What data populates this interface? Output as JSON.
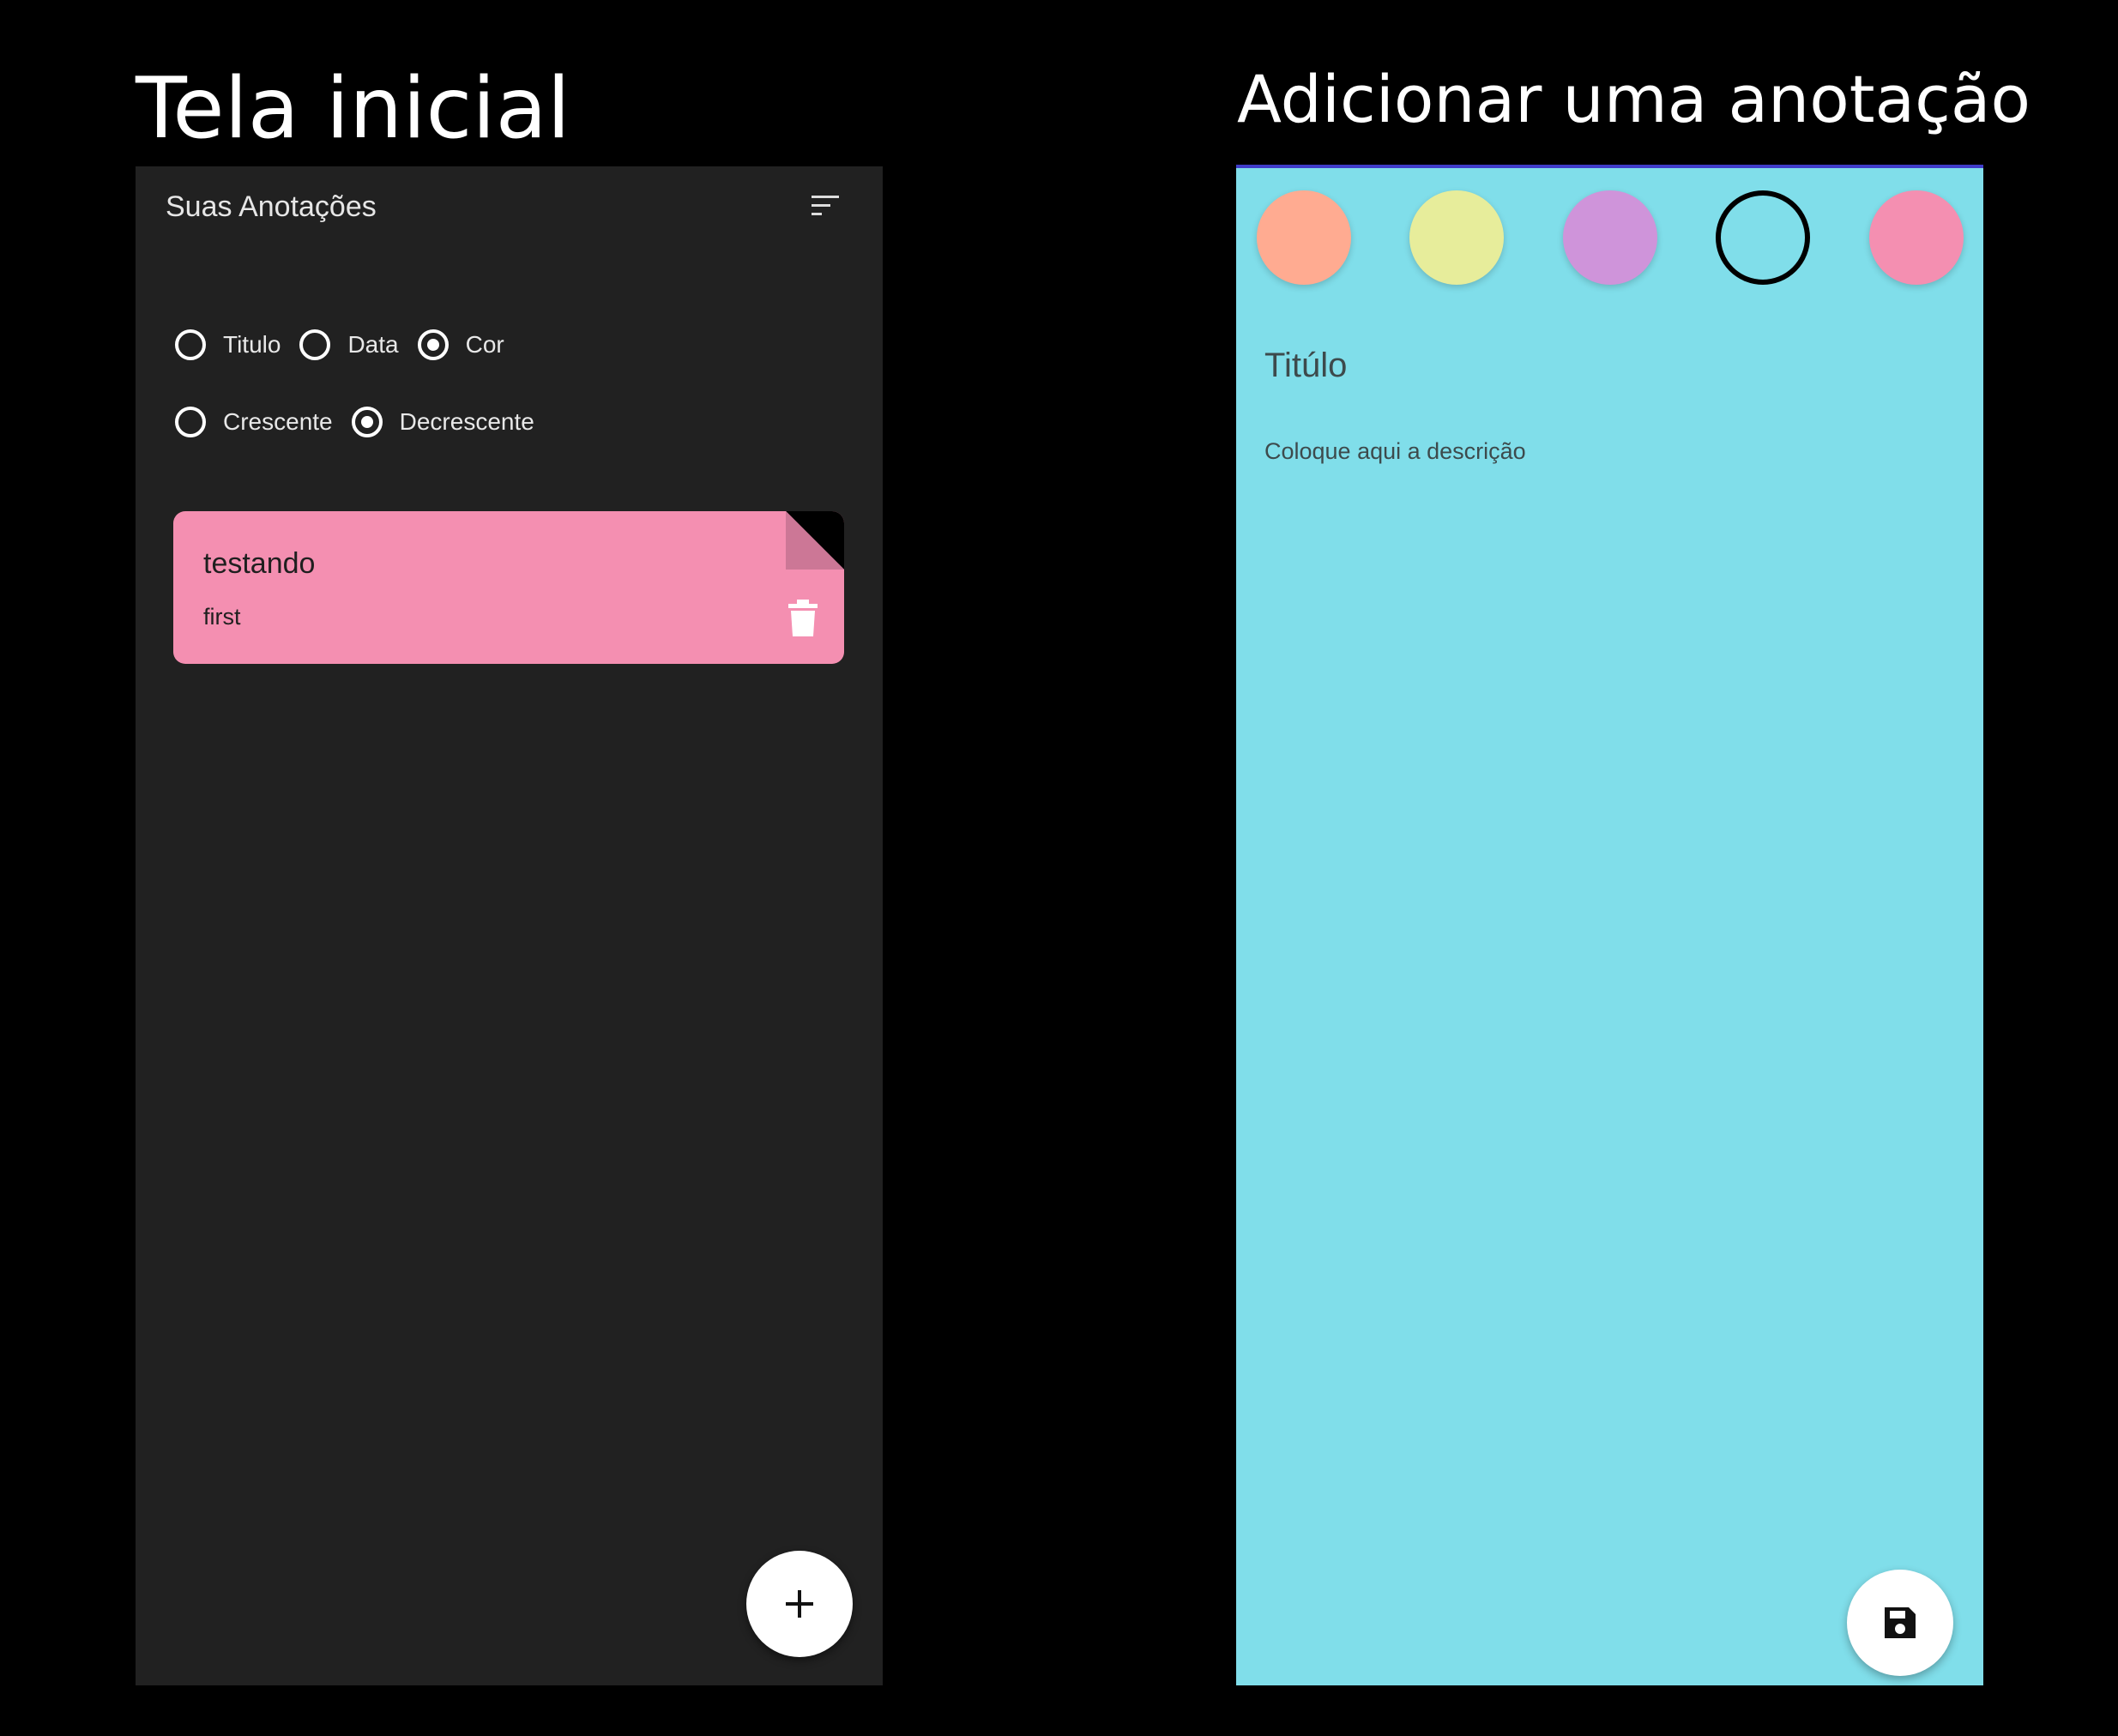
{
  "captions": {
    "home": "Tela inicial",
    "add": "Adicionar uma anotação"
  },
  "home": {
    "title": "Suas Anotações",
    "sort_icon": "sort-icon",
    "order_by": [
      {
        "label": "Titulo",
        "checked": false
      },
      {
        "label": "Data",
        "checked": false
      },
      {
        "label": "Cor",
        "checked": true
      }
    ],
    "direction": [
      {
        "label": "Crescente",
        "checked": false
      },
      {
        "label": "Decrescente",
        "checked": true
      }
    ],
    "notes": [
      {
        "title": "testando",
        "description": "first",
        "color": "#f48fb1",
        "delete_icon": "trash-icon"
      }
    ],
    "fab_icon": "plus-icon"
  },
  "add_note": {
    "colors": [
      {
        "hex": "#ffab91",
        "selected": false
      },
      {
        "hex": "#e7ed9b",
        "selected": false
      },
      {
        "hex": "#cf94da",
        "selected": false
      },
      {
        "hex": "#80deea",
        "selected": true
      },
      {
        "hex": "#f48fb1",
        "selected": false
      }
    ],
    "title_placeholder": "Titúlo",
    "description_placeholder": "Coloque aqui a descrição",
    "fab_icon": "save-icon"
  },
  "theme": {
    "page_bg": "#000000",
    "home_bg": "#212121",
    "accent_line": "#3f3cc9"
  }
}
